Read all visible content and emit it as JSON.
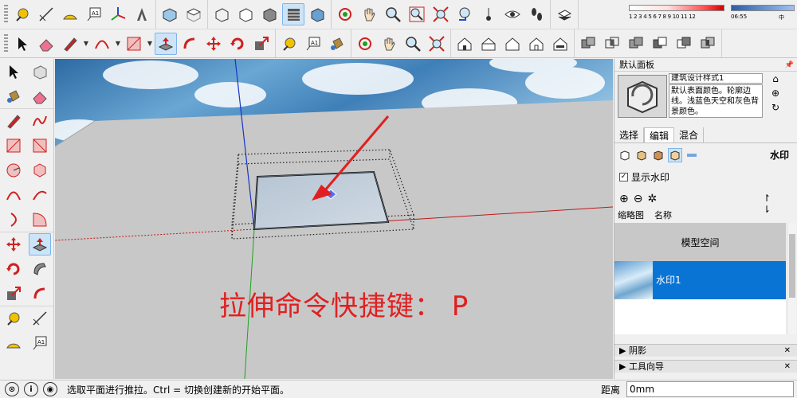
{
  "shadow": {
    "months": "1 2 3 4 5 6 7 8 9 10 11 12",
    "time_start": "06:55",
    "time_end": "中"
  },
  "panel": {
    "title": "默认面板",
    "style_name": "建筑设计样式1",
    "style_description": "默认表面颜色。轮廓边线。浅蓝色天空和灰色背景颜色。",
    "tabs": [
      "选择",
      "编辑",
      "混合"
    ],
    "active_tab": "编辑",
    "section_label": "水印",
    "show_watermark_label": "显示水印",
    "show_watermark_checked": true,
    "col_thumbnail": "缩略图",
    "col_name": "名称",
    "rows": [
      {
        "name": "模型空间"
      },
      {
        "name": "水印1"
      }
    ],
    "collapsed_sections": [
      "阴影",
      "工具向导"
    ]
  },
  "viewport": {
    "caption": "拉伸命令快捷键： P",
    "sky_color": "#3f7fb8",
    "ground_color": "#c8c8c8"
  },
  "status": {
    "message": "选取平面进行推拉。Ctrl = 切换创建新的开始平面。",
    "distance_label": "距离",
    "distance_value": "0mm"
  },
  "colors": {
    "accent": "#0a74d4",
    "caption_red": "#e02020"
  }
}
